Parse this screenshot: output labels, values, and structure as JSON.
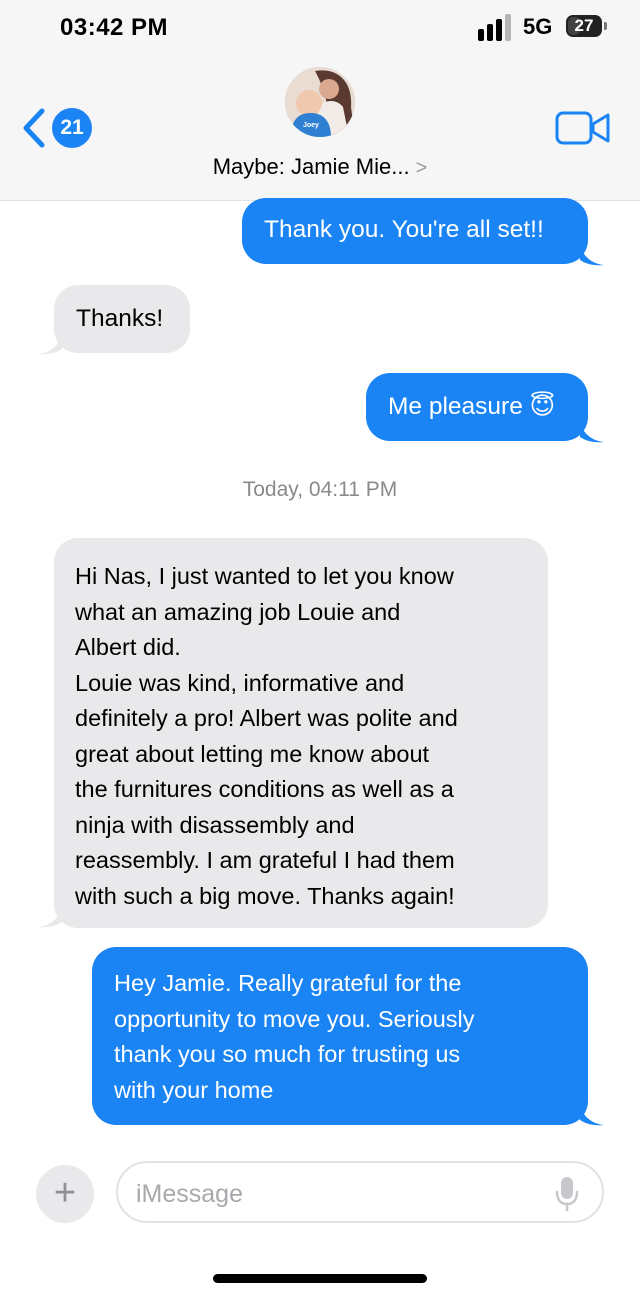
{
  "status_bar": {
    "time": "03:42 PM",
    "network": "5G",
    "battery": "27"
  },
  "header": {
    "unread_count": "21",
    "contact_name": "Maybe: Jamie Mie...",
    "contact_arrow": ">",
    "avatar_caption": "Joey"
  },
  "messages": [
    {
      "direction": "sent",
      "text": "Thank you. You're all set!!"
    },
    {
      "direction": "received",
      "text": "Thanks!"
    },
    {
      "direction": "sent",
      "text": "Me pleasure 😇"
    },
    {
      "direction": "received",
      "text": "Hi Nas, I just wanted to let you know\nwhat an amazing job Louie and\nAlbert did.\nLouie was kind, informative and\ndefinitely a pro! Albert was polite and\ngreat about letting me know about\nthe furnitures conditions as well as a\nninja with disassembly and\nreassembly. I am grateful I had them\nwith such a big move. Thanks again!"
    },
    {
      "direction": "sent",
      "text": "Hey Jamie. Really grateful for the\nopportunity to move you. Seriously\nthank you so much for trusting us\nwith your home"
    }
  ],
  "timestamp": "Today, 04:11 PM",
  "composer": {
    "placeholder": "iMessage",
    "plus_label": "+"
  },
  "colors": {
    "sent_bubble": "#1a84f4",
    "received_bubble": "#e9e9eb",
    "accent": "#1a84f4"
  }
}
